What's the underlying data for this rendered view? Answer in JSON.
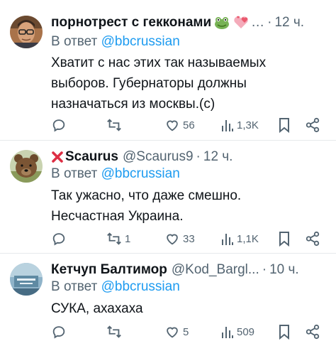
{
  "tweets": [
    {
      "name": "порнотрест с гекконами",
      "handle": "",
      "time": "12 ч.",
      "reply_prefix": "В ответ",
      "reply_to": "@bbcrussian",
      "text_lines": [
        "Хватит с нас этих так называемых",
        "выборов. Губернаторы должны",
        "назначаться из москвы.(с)"
      ],
      "replies": "",
      "retweets": "",
      "likes": "56",
      "views": "1,3K",
      "avatar": "man-with-glasses-photo",
      "emojis": [
        "frog-icon",
        "pink-hearts-icon"
      ],
      "truncation": "…"
    },
    {
      "name": "Scaurus",
      "handle": "@Scaurus9",
      "time": "12 ч.",
      "reply_prefix": "В ответ",
      "reply_to": "@bbcrussian",
      "text_lines": [
        "Так ужасно, что даже смешно.",
        "Несчастная Украина."
      ],
      "replies": "",
      "retweets": "1",
      "likes": "33",
      "views": "1,1K",
      "avatar": "bear-photo",
      "emojis": [
        "red-cross-icon"
      ]
    },
    {
      "name": "Кетчуп Балтимор",
      "handle": "@Kod_Bargl...",
      "time": "10 ч.",
      "reply_prefix": "В ответ",
      "reply_to": "@bbcrussian",
      "text_lines": [
        "СУКА, ахахаха"
      ],
      "replies": "",
      "retweets": "",
      "likes": "5",
      "views": "509",
      "avatar": "blue-image-avatar"
    }
  ],
  "colors": {
    "text": "#0f1419",
    "muted": "#536471",
    "link": "#1d9bf0",
    "divider": "#e6e9ec"
  }
}
